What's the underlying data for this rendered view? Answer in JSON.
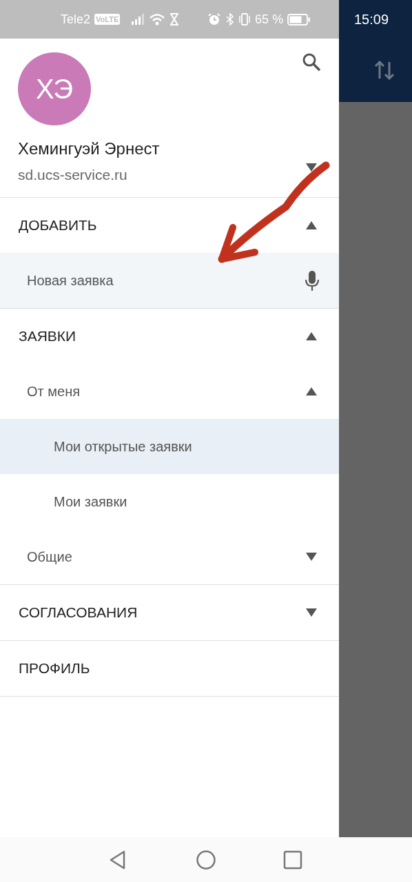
{
  "status_bar": {
    "carrier": "Tele2",
    "volte": "VoLTE",
    "battery_percent": "65 %",
    "time": "15:09"
  },
  "profile": {
    "initials": "ХЭ",
    "name": "Хемингуэй Эрнест",
    "server": "sd.ucs-service.ru"
  },
  "menu": [
    {
      "label": "ДОБАВИТЬ",
      "expanded": true,
      "children": [
        {
          "label": "Новая заявка",
          "kind": "action"
        }
      ]
    },
    {
      "label": "ЗАЯВКИ",
      "expanded": true,
      "children": [
        {
          "label": "От меня",
          "kind": "group",
          "expanded": true,
          "children": [
            {
              "label": "Мои открытые заявки",
              "kind": "link",
              "selected": true
            },
            {
              "label": "Мои заявки",
              "kind": "link",
              "selected": false
            }
          ]
        },
        {
          "label": "Общие",
          "kind": "group",
          "expanded": false
        }
      ]
    },
    {
      "label": "СОГЛАСОВАНИЯ",
      "expanded": false
    },
    {
      "label": "ПРОФИЛЬ"
    }
  ]
}
